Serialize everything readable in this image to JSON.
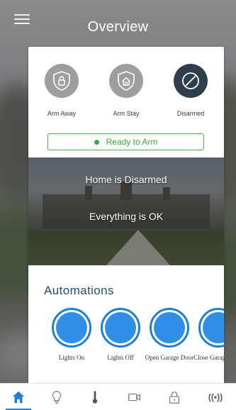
{
  "header": {
    "title": "Overview",
    "menu_icon": "menu-icon"
  },
  "modes": [
    {
      "label": "Arm Away",
      "icon": "shield-lock-icon",
      "active": false
    },
    {
      "label": "Arm Stay",
      "icon": "shield-home-icon",
      "active": false
    },
    {
      "label": "Disarmed",
      "icon": "disarmed-icon",
      "active": true
    }
  ],
  "ready_status": "Ready to Arm",
  "status": {
    "line1": "Home is Disarmed",
    "line2": "Everything is OK"
  },
  "automations": {
    "title": "Automations",
    "items": [
      {
        "label": "Lights On"
      },
      {
        "label": "Lights Off"
      },
      {
        "label": "Open Garage Door"
      },
      {
        "label": "Close Garage Door"
      }
    ]
  },
  "tabs": [
    {
      "icon": "home-icon",
      "active": true
    },
    {
      "icon": "lightbulb-icon",
      "active": false
    },
    {
      "icon": "thermometer-icon",
      "active": false
    },
    {
      "icon": "camera-icon",
      "active": false
    },
    {
      "icon": "lock-icon",
      "active": false
    },
    {
      "icon": "sensor-icon",
      "label": "((•))",
      "active": false
    }
  ],
  "colors": {
    "accent": "#1e7fd6",
    "ready": "#3aa640",
    "mode_inactive": "#9e9e9e",
    "mode_active": "#2f3d4c",
    "title": "#254a7a"
  }
}
